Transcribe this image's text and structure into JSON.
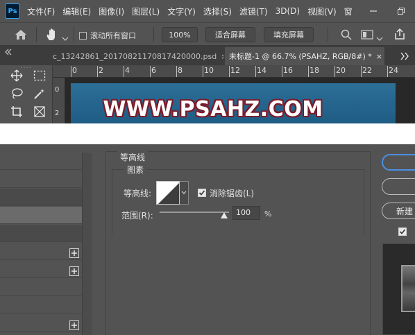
{
  "app": {
    "logo": "Ps"
  },
  "menu": [
    "文件(F)",
    "编辑(E)",
    "图像(I)",
    "图层(L)",
    "文字(Y)",
    "选择(S)",
    "滤镜(T)",
    "3D(D)",
    "视图(V)",
    "窗"
  ],
  "options": {
    "scroll_all_label": "滚动所有窗口",
    "zoom_label": "100%",
    "fit_screen_label": "适合屏幕",
    "fill_screen_label": "填充屏幕"
  },
  "tabs": [
    {
      "label": "c_13242861_20170821170817420000.psd",
      "close": "×"
    },
    {
      "label": "未标题-1 @ 66.7% (PSAHZ, RGB/8#) *",
      "close": "×"
    }
  ],
  "ruler_h": [
    "0",
    "2",
    "4",
    "6",
    "8",
    "10",
    "12",
    "14",
    "16",
    "18",
    "20",
    "22",
    "24"
  ],
  "ruler_v": [
    "0",
    "2"
  ],
  "canvas": {
    "text": "WWW.PSAHZ.COM"
  },
  "layer_style": {
    "section_title": "等高线",
    "group_title": "图素",
    "contour_label": "等高线:",
    "anti_alias_label": "消除锯齿(L)",
    "anti_alias_checked": true,
    "range_label": "范围(R):",
    "range_value": "100",
    "range_unit": "%",
    "new_style_label": "新建",
    "preview_checked": true
  },
  "colors": {
    "accent": "#4a90e2",
    "canvas_bg": "#1f5c84",
    "text_outline": "#7a1d2c"
  }
}
